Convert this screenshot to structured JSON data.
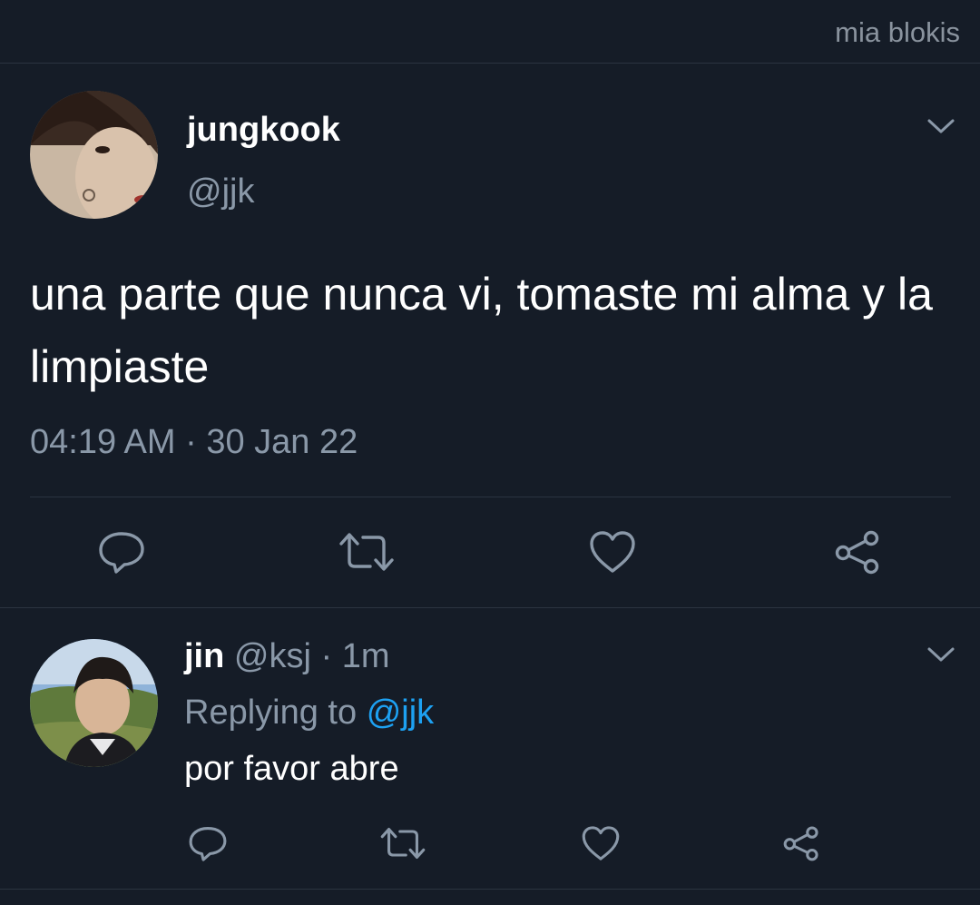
{
  "watermark": "mia blokis",
  "main_tweet": {
    "display_name": "jungkook",
    "handle": "@jjk",
    "text": "una parte que nunca vi, tomaste mi alma y la limpiaste",
    "time": "04:19 AM",
    "separator": "·",
    "date": "30 Jan 22",
    "actions": [
      "reply-icon",
      "retweet-icon",
      "like-icon",
      "share-icon"
    ],
    "menu_icon": "chevron-down-icon"
  },
  "reply": {
    "display_name": "jin",
    "handle": "@ksj",
    "separator": "·",
    "time_ago": "1m",
    "replying_label": "Replying to",
    "replying_to": "@jjk",
    "text": "por favor abre",
    "actions": [
      "reply-icon",
      "retweet-icon",
      "like-icon",
      "share-icon"
    ],
    "menu_icon": "chevron-down-icon"
  },
  "colors": {
    "background": "#151c27",
    "text_primary": "#ffffff",
    "text_muted": "#8a98a8",
    "mention": "#1da1f2",
    "divider": "#2b3440"
  }
}
